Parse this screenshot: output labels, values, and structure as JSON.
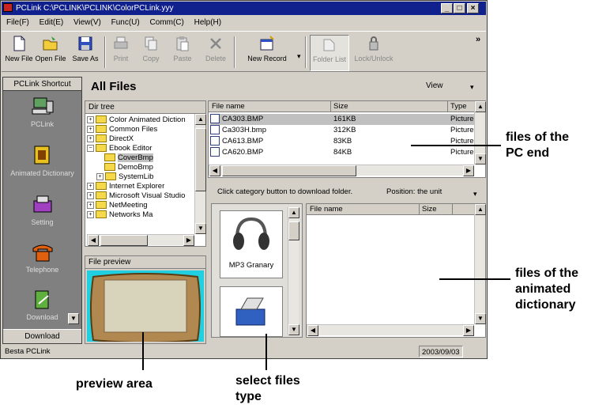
{
  "window": {
    "title": "PCLink C:\\PCLINK\\PCLINK\\ColorPCLink.yyy"
  },
  "menu": [
    "File(F)",
    "Edit(E)",
    "View(V)",
    "Func(U)",
    "Comm(C)",
    "Help(H)"
  ],
  "toolbar": {
    "items": [
      "New File",
      "Open File",
      "Save As",
      "Print",
      "Copy",
      "Paste",
      "Delete",
      "New Record",
      "Folder List",
      "Lock/Unlock"
    ],
    "overflow": "»"
  },
  "sidebar": {
    "title": "PCLink Shortcut",
    "items": [
      "PCLink",
      "Animated Dictionary",
      "Setting",
      "Telephone",
      "Download"
    ],
    "footer": "Download"
  },
  "main": {
    "title": "All Files",
    "view_label": "View"
  },
  "dir_tree": {
    "header": "Dir tree",
    "items": [
      "Color Animated Diction",
      "Common Files",
      "DirectX",
      "Ebook Editor",
      "CoverBmp",
      "DemoBmp",
      "SystemLib",
      "Internet Explorer",
      "Microsoft Visual Studio",
      "NetMeeting",
      "Networks Ma"
    ]
  },
  "file_list": {
    "columns": [
      "File name",
      "Size",
      "Type"
    ],
    "rows": [
      {
        "name": "CA303.BMP",
        "size": "161KB",
        "type": "Picture"
      },
      {
        "name": "Ca303H.bmp",
        "size": "312KB",
        "type": "Picture"
      },
      {
        "name": "CA613.BMP",
        "size": "83KB",
        "type": "Picture"
      },
      {
        "name": "CA620.BMP",
        "size": "84KB",
        "type": "Picture"
      }
    ]
  },
  "download_bar": {
    "hint": "Click category button to download folder.",
    "position": "Position: the unit"
  },
  "categories": [
    "MP3 Granary",
    ""
  ],
  "device_list": {
    "columns": [
      "File name",
      "Size"
    ]
  },
  "preview": {
    "header": "File preview"
  },
  "status": {
    "left": "Besta PCLink",
    "date": "2003/09/03"
  },
  "callouts": {
    "pc_end": "files of the\nPC end",
    "dictionary": "files of the\nanimated\ndictionary",
    "preview": "preview area",
    "select": "select files\ntype"
  }
}
